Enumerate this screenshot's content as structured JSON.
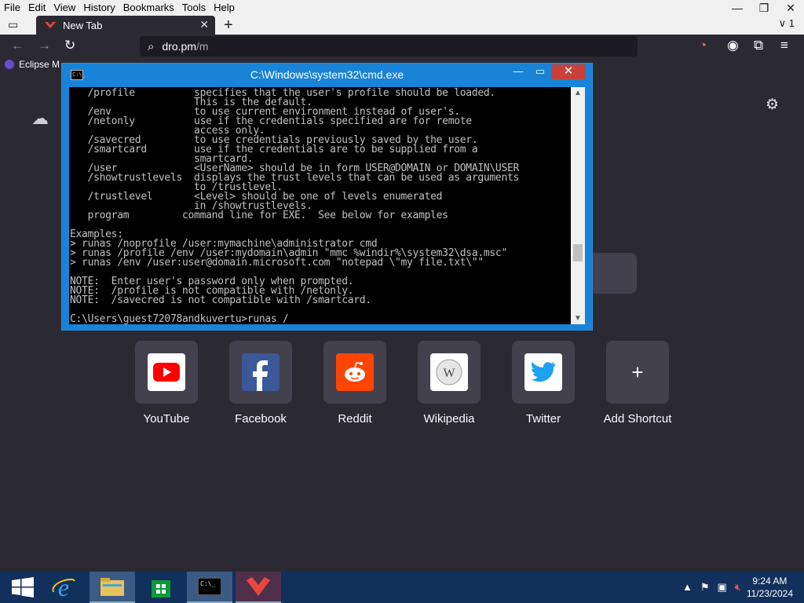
{
  "menu": {
    "items": [
      "File",
      "Edit",
      "View",
      "History",
      "Bookmarks",
      "Tools",
      "Help"
    ]
  },
  "browser": {
    "tab_title": "New Tab",
    "url_host": "dro.pm",
    "url_path": "/m",
    "bookmark": "Eclipse M"
  },
  "newtab": {
    "shortcuts": [
      {
        "label": "YouTube",
        "icon": "youtube-icon",
        "color": "#ff0000"
      },
      {
        "label": "Facebook",
        "icon": "facebook-icon",
        "color": "#3b5998"
      },
      {
        "label": "Reddit",
        "icon": "reddit-icon",
        "color": "#ff4500"
      },
      {
        "label": "Wikipedia",
        "icon": "wikipedia-icon",
        "color": "#ffffff"
      },
      {
        "label": "Twitter",
        "icon": "twitter-icon",
        "color": "#1da1f2"
      },
      {
        "label": "Add Shortcut",
        "icon": "plus-icon",
        "color": "#42414d"
      }
    ]
  },
  "cmd": {
    "title": "C:\\Windows\\system32\\cmd.exe",
    "lines": [
      "   /profile          specifies that the user's profile should be loaded.",
      "                     This is the default.",
      "   /env              to use current environment instead of user's.",
      "   /netonly          use if the credentials specified are for remote",
      "                     access only.",
      "   /savecred         to use credentials previously saved by the user.",
      "   /smartcard        use if the credentials are to be supplied from a",
      "                     smartcard.",
      "   /user             <UserName> should be in form USER@DOMAIN or DOMAIN\\USER",
      "   /showtrustlevels  displays the trust levels that can be used as arguments",
      "                     to /trustlevel.",
      "   /trustlevel       <Level> should be one of levels enumerated",
      "                     in /showtrustlevels.",
      "   program         command line for EXE.  See below for examples",
      "",
      "Examples:",
      "> runas /noprofile /user:mymachine\\administrator cmd",
      "> runas /profile /env /user:mydomain\\admin \"mmc %windir%\\system32\\dsa.msc\"",
      "> runas /env /user:user@domain.microsoft.com \"notepad \\\"my file.txt\\\"\"",
      "",
      "NOTE:  Enter user's password only when prompted.",
      "NOTE:  /profile is not compatible with /netonly.",
      "NOTE:  /savecred is not compatible with /smartcard.",
      "",
      "C:\\Users\\guest72078andkuvertu>runas /"
    ]
  },
  "taskbar": {
    "time": "9:24 AM",
    "date": "11/23/2024"
  }
}
